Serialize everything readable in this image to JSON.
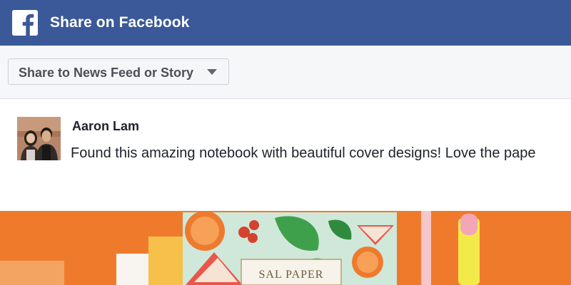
{
  "header": {
    "logo_icon": "facebook-f-icon",
    "title": "Share on Facebook",
    "color": "#3b5998"
  },
  "toolbar": {
    "share_target_label": "Share to News Feed or Story",
    "dropdown_icon": "chevron-down-icon"
  },
  "post": {
    "author": "Aaron Lam",
    "text": "Found this amazing notebook with beautiful cover designs! Love the pape",
    "avatar_icon": "user-avatar"
  },
  "preview": {
    "background_color": "#f07a2c",
    "notebook_title": "SAL PAPER"
  }
}
